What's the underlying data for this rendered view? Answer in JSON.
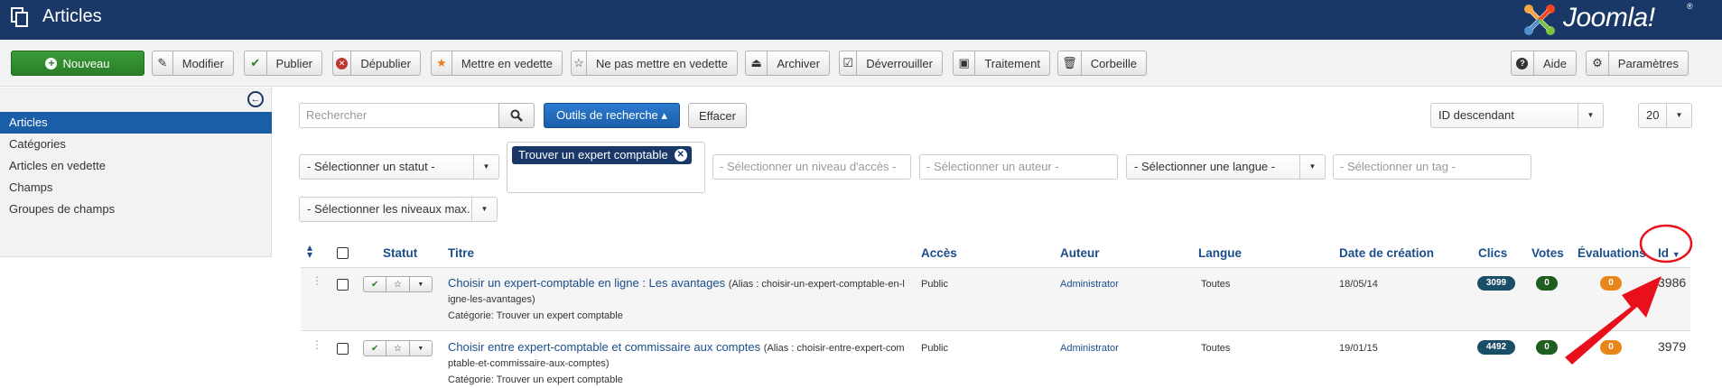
{
  "header": {
    "title": "Articles",
    "logo_text": "Joomla!",
    "logo_mark": "®"
  },
  "toolbar": {
    "new_label": "Nouveau",
    "buttons": [
      {
        "label": "Modifier",
        "icon": "edit-icon"
      },
      {
        "label": "Publier",
        "icon": "check-icon"
      },
      {
        "label": "Dépublier",
        "icon": "unpublish-icon"
      },
      {
        "label": "Mettre en vedette",
        "icon": "star-filled-icon"
      },
      {
        "label": "Ne pas mettre en vedette",
        "icon": "star-outline-icon"
      },
      {
        "label": "Archiver",
        "icon": "archive-icon"
      },
      {
        "label": "Déverrouiller",
        "icon": "checkbox-icon"
      },
      {
        "label": "Traitement",
        "icon": "batch-icon"
      },
      {
        "label": "Corbeille",
        "icon": "trash-icon"
      }
    ],
    "help_label": "Aide",
    "options_label": "Paramètres"
  },
  "sidebar": {
    "items": [
      {
        "label": "Articles",
        "active": true
      },
      {
        "label": "Catégories"
      },
      {
        "label": "Articles en vedette"
      },
      {
        "label": "Champs"
      },
      {
        "label": "Groupes de champs"
      }
    ]
  },
  "search": {
    "placeholder": "Rechercher",
    "tools_label": "Outils de recherche ▴",
    "clear_label": "Effacer",
    "ordering": "ID descendant",
    "limit": "20"
  },
  "filters": {
    "status": "- Sélectionner un statut -",
    "category_tag": "Trouver un expert comptable",
    "access": "- Sélectionner un niveau d'accès -",
    "author": "- Sélectionner un auteur -",
    "language": "- Sélectionner une langue -",
    "tag": "- Sélectionner un tag -",
    "max_levels": "- Sélectionner les niveaux max."
  },
  "table": {
    "headers": {
      "status": "Statut",
      "title": "Titre",
      "access": "Accès",
      "author": "Auteur",
      "language": "Langue",
      "date": "Date de création",
      "hits": "Clics",
      "votes": "Votes",
      "ratings": "Évaluations",
      "id": "Id"
    },
    "rows": [
      {
        "title": "Choisir un expert-comptable en ligne : Les avantages",
        "alias_1": "(Alias : choisir-un-expert-comptable-en-l",
        "alias_2": "igne-les-avantages)",
        "category": "Catégorie: Trouver un expert comptable",
        "access": "Public",
        "author": "Administrator",
        "language": "Toutes",
        "date": "18/05/14",
        "hits": "3099",
        "votes": "0",
        "ratings": "0",
        "id": "3986"
      },
      {
        "title": "Choisir entre expert-comptable et commissaire aux comptes",
        "alias_1": "(Alias : choisir-entre-expert-com",
        "alias_2": "ptable-et-commissaire-aux-comptes)",
        "category": "Catégorie: Trouver un expert comptable",
        "access": "Public",
        "author": "Administrator",
        "language": "Toutes",
        "date": "19/01/15",
        "hits": "4492",
        "votes": "0",
        "ratings": "0",
        "id": "3979"
      }
    ]
  },
  "colors": {
    "header_bg": "#1a3867",
    "new_button": "#2a7f28",
    "active_sidebar": "#1a5ea8",
    "hits_badge": "#1a4d66",
    "votes_badge": "#1e5e1e",
    "ratings_badge": "#e8861a",
    "annotation_red": "#e8101a"
  }
}
